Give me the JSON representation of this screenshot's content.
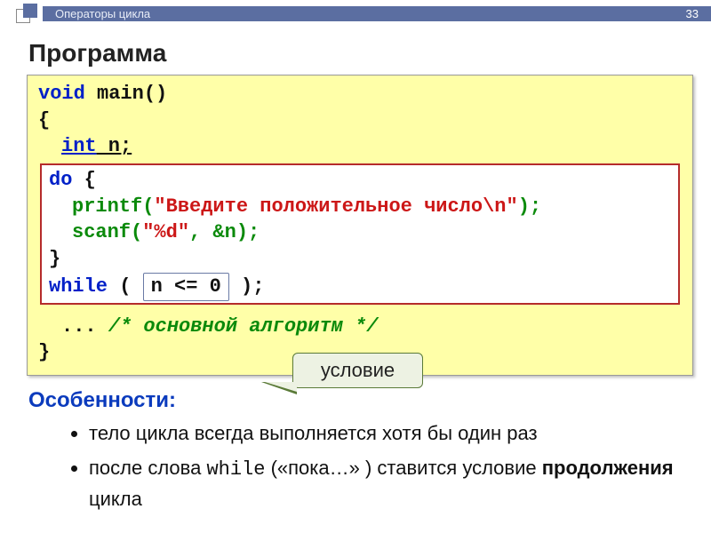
{
  "header": {
    "breadcrumb": "Операторы цикла",
    "page_number": "33"
  },
  "title": "Программа",
  "code": {
    "sig1": "void",
    "sig2": " main()",
    "brace_open": "{",
    "intkw": "int",
    "intvar": " n;",
    "do_kw": "do",
    "do_brace": " {",
    "printf": "printf",
    "printf_open": "(",
    "printf_str": "\"Введите положительное число\\n\"",
    "printf_close": ");",
    "scanf": "scanf",
    "scanf_open": "(",
    "scanf_str": "\"%d\"",
    "scanf_mid": ", &n);",
    "inner_close": "}",
    "while_kw": "while",
    "while_open": " ( ",
    "while_cond": "n <= 0",
    "while_close": " );",
    "ellipsis": "... ",
    "comment": "/* основной алгоритм */",
    "brace_close": "}"
  },
  "callout": "условие",
  "features_label": "Особенности:",
  "bullets": {
    "b1": "тело цикла всегда выполняется хотя бы один раз",
    "b2a": "после слова ",
    "b2_mono": "while",
    "b2b": " («пока…» ) ставится условие ",
    "b2_bold": "продолжения",
    "b2c": " цикла"
  }
}
